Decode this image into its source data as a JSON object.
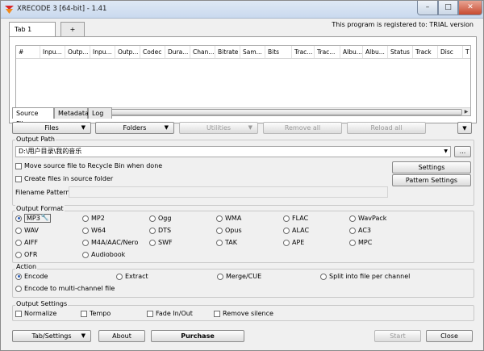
{
  "window": {
    "title": "XRECODE 3 [64-bit] - 1.41",
    "minimize": "–",
    "maximize": "□",
    "close": "✕"
  },
  "top_tabs": [
    "Tab 1",
    "+"
  ],
  "registration": "This program is registered to: TRIAL version",
  "columns": [
    "#",
    "Inpu...",
    "Outp...",
    "Inpu...",
    "Outp...",
    "Codec",
    "Dura...",
    "Chan...",
    "Bitrate",
    "Sam...",
    "Bits",
    "Trac...",
    "Trac...",
    "Albu...",
    "Albu...",
    "Status",
    "Track",
    "Disc",
    "T"
  ],
  "bottom_tabs": [
    "Source Files",
    "Metadata",
    "Log"
  ],
  "toolbar": {
    "files": "Files",
    "folders": "Folders",
    "utilities": "Utilities",
    "remove_all": "Remove all",
    "reload_all": "Reload all"
  },
  "output_path": {
    "label": "Output Path",
    "value": "D:\\用户目录\\我的音乐",
    "browse": "...",
    "move_to_recycle": "Move source file to Recycle Bin when done",
    "create_in_source": "Create files in source folder",
    "filename_pattern_label": "Filename Pattern:",
    "filename_pattern_value": "",
    "settings": "Settings",
    "pattern_settings": "Pattern Settings"
  },
  "output_format": {
    "label": "Output Format",
    "options": [
      "MP3",
      "MP2",
      "Ogg",
      "WMA",
      "FLAC",
      "WavPack",
      "WAV",
      "W64",
      "DTS",
      "Opus",
      "ALAC",
      "AC3",
      "AIFF",
      "M4A/AAC/Nero",
      "SWF",
      "TAK",
      "APE",
      "MPC",
      "OFR",
      "Audiobook"
    ],
    "selected": "MP3"
  },
  "action": {
    "label": "Action",
    "options": [
      "Encode",
      "Extract",
      "Merge/CUE",
      "Split into file per channel",
      "Encode to multi-channel file"
    ],
    "selected": "Encode"
  },
  "output_settings": {
    "label": "Output Settings",
    "options": [
      "Normalize",
      "Tempo",
      "Fade In/Out",
      "Remove silence"
    ]
  },
  "footer": {
    "tab_settings": "Tab/Settings",
    "about": "About",
    "purchase": "Purchase",
    "start": "Start",
    "close": "Close"
  },
  "colors": {
    "accent": "#2a5db8",
    "title_gradient": "#c9d9ee"
  }
}
